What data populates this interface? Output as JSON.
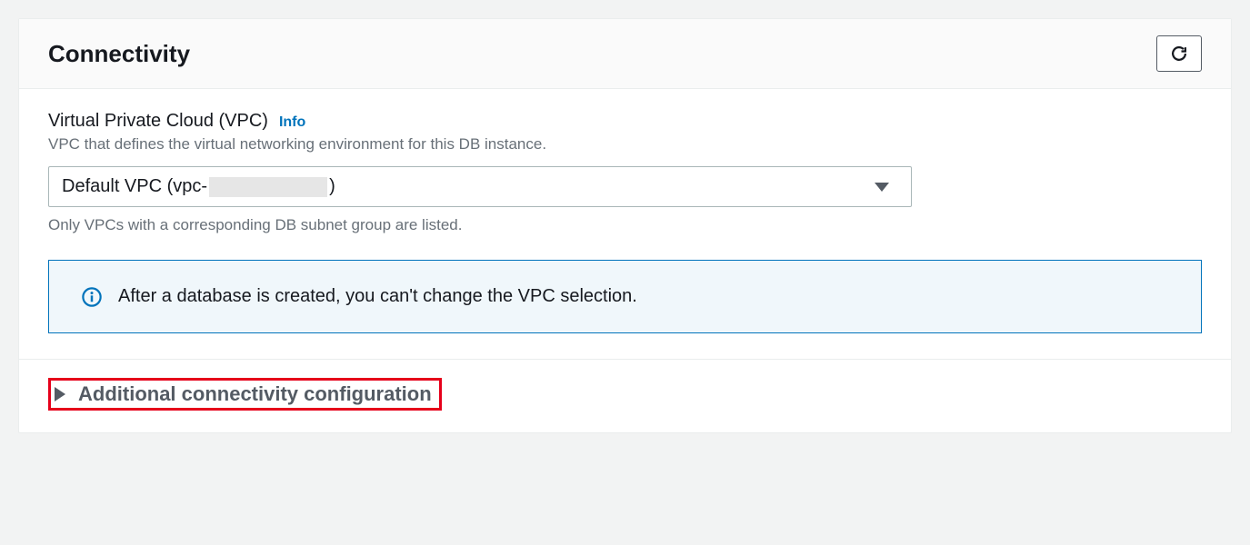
{
  "panel": {
    "title": "Connectivity"
  },
  "vpc": {
    "label": "Virtual Private Cloud (VPC)",
    "infoLabel": "Info",
    "description": "VPC that defines the virtual networking environment for this DB instance.",
    "selectedPrefix": "Default VPC (vpc-",
    "selectedSuffix": ")",
    "hint": "Only VPCs with a corresponding DB subnet group are listed."
  },
  "alert": {
    "text": "After a database is created, you can't change the VPC selection."
  },
  "expand": {
    "label": "Additional connectivity configuration"
  }
}
